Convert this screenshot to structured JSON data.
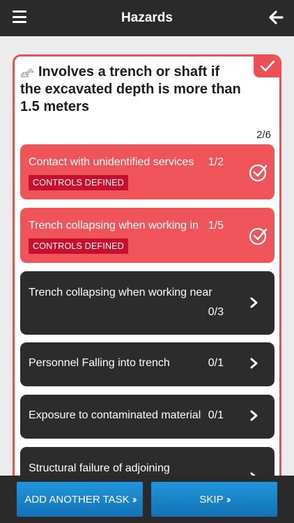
{
  "header": {
    "title": "Hazards"
  },
  "task": {
    "title": "Involves a trench or shaft if the excavated depth is more than 1.5 meters",
    "counter": "2/6"
  },
  "hazards": [
    {
      "label": "Contact with unidentified services",
      "count": "1/2",
      "status": "CONTROLS DEFINED"
    },
    {
      "label": "Trench collapsing when working in",
      "count": "1/5",
      "status": "CONTROLS DEFINED"
    },
    {
      "label": "Trench collapsing when working near",
      "count": "0/3"
    },
    {
      "label": "Personnel Falling into trench",
      "count": "0/1"
    },
    {
      "label": "Exposure to contaminated material",
      "count": "0/1"
    },
    {
      "label": "Structural failure of adjoining"
    }
  ],
  "footer": {
    "add_task": "ADD ANOTHER TASK",
    "skip": "SKIP"
  },
  "colors": {
    "header": "#2a2a2a",
    "accent": "#ee4f55",
    "completed": "#f0545b",
    "pending": "#2c2c2c",
    "badge": "#c8102e",
    "button": "#1a84cc"
  },
  "icons": {
    "menu": "hamburger-menu-icon",
    "back": "arrow-left-icon",
    "done": "check-circle-icon",
    "next": "chevron-right-icon",
    "task": "excavator-icon"
  }
}
